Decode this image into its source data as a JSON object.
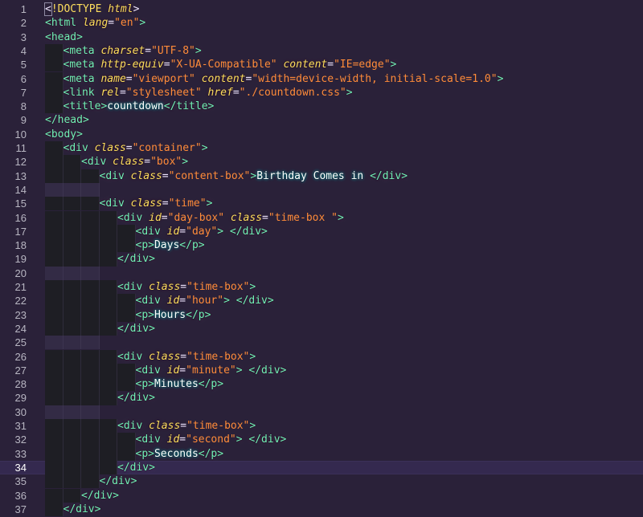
{
  "editor": {
    "language": "html",
    "active_line": 34,
    "lines": [
      {
        "n": "1",
        "indent": 0,
        "tokens": [
          [
            "punc",
            "<"
          ],
          [
            "doc",
            "!DOCTYPE "
          ],
          [
            "attr",
            "html"
          ],
          [
            "punc",
            ">"
          ]
        ]
      },
      {
        "n": "2",
        "indent": 0,
        "tokens": [
          [
            "tag",
            "<html "
          ],
          [
            "attr",
            "lang"
          ],
          [
            "punc",
            "="
          ],
          [
            "str",
            "\"en\""
          ],
          [
            "tag",
            ">"
          ]
        ]
      },
      {
        "n": "3",
        "indent": 0,
        "tokens": [
          [
            "tag",
            "<head>"
          ]
        ]
      },
      {
        "n": "4",
        "indent": 1,
        "tokens": [
          [
            "tag",
            "<meta "
          ],
          [
            "attr",
            "charset"
          ],
          [
            "punc",
            "="
          ],
          [
            "str",
            "\"UTF-8\""
          ],
          [
            "tag",
            ">"
          ]
        ]
      },
      {
        "n": "5",
        "indent": 1,
        "tokens": [
          [
            "tag",
            "<meta "
          ],
          [
            "attr",
            "http-equiv"
          ],
          [
            "punc",
            "="
          ],
          [
            "str",
            "\"X-UA-Compatible\" "
          ],
          [
            "attr",
            "content"
          ],
          [
            "punc",
            "="
          ],
          [
            "str",
            "\"IE=edge\""
          ],
          [
            "tag",
            ">"
          ]
        ]
      },
      {
        "n": "6",
        "indent": 1,
        "tokens": [
          [
            "tag",
            "<meta "
          ],
          [
            "attr",
            "name"
          ],
          [
            "punc",
            "="
          ],
          [
            "str",
            "\"viewport\" "
          ],
          [
            "attr",
            "content"
          ],
          [
            "punc",
            "="
          ],
          [
            "str",
            "\"width=device-width, initial-scale=1.0\""
          ],
          [
            "tag",
            ">"
          ]
        ]
      },
      {
        "n": "7",
        "indent": 1,
        "tokens": [
          [
            "tag",
            "<link "
          ],
          [
            "attr",
            "rel"
          ],
          [
            "punc",
            "="
          ],
          [
            "str",
            "\"stylesheet\" "
          ],
          [
            "attr",
            "href"
          ],
          [
            "punc",
            "="
          ],
          [
            "str",
            "\"./countdown.css\""
          ],
          [
            "tag",
            ">"
          ]
        ]
      },
      {
        "n": "8",
        "indent": 1,
        "tokens": [
          [
            "tag",
            "<title>"
          ],
          [
            "txt",
            "countdown"
          ],
          [
            "tag",
            "</title>"
          ]
        ]
      },
      {
        "n": "9",
        "indent": 0,
        "tokens": [
          [
            "tag",
            "</head>"
          ]
        ]
      },
      {
        "n": "10",
        "indent": 0,
        "tokens": [
          [
            "tag",
            "<body>"
          ]
        ]
      },
      {
        "n": "11",
        "indent": 1,
        "tokens": [
          [
            "tag",
            "<div "
          ],
          [
            "attr",
            "class"
          ],
          [
            "punc",
            "="
          ],
          [
            "str",
            "\"container\""
          ],
          [
            "tag",
            ">"
          ]
        ]
      },
      {
        "n": "12",
        "indent": 2,
        "tokens": [
          [
            "tag",
            "<div "
          ],
          [
            "attr",
            "class"
          ],
          [
            "punc",
            "="
          ],
          [
            "str",
            "\"box\""
          ],
          [
            "tag",
            ">"
          ]
        ]
      },
      {
        "n": "13",
        "indent": 3,
        "tokens": [
          [
            "tag",
            "<div "
          ],
          [
            "attr",
            "class"
          ],
          [
            "punc",
            "="
          ],
          [
            "str",
            "\"content-box\""
          ],
          [
            "tag",
            ">"
          ],
          [
            "txt",
            "Birthday Comes in "
          ],
          [
            "tag",
            "</div>"
          ]
        ]
      },
      {
        "n": "14",
        "indent": 3,
        "blank": true,
        "tokens": []
      },
      {
        "n": "15",
        "indent": 3,
        "tokens": [
          [
            "tag",
            "<div "
          ],
          [
            "attr",
            "class"
          ],
          [
            "punc",
            "="
          ],
          [
            "str",
            "\"time\""
          ],
          [
            "tag",
            ">"
          ]
        ]
      },
      {
        "n": "16",
        "indent": 4,
        "tokens": [
          [
            "tag",
            "<div "
          ],
          [
            "attr",
            "id"
          ],
          [
            "punc",
            "="
          ],
          [
            "str",
            "\"day-box\" "
          ],
          [
            "attr",
            "class"
          ],
          [
            "punc",
            "="
          ],
          [
            "str",
            "\"time-box \""
          ],
          [
            "tag",
            ">"
          ]
        ]
      },
      {
        "n": "17",
        "indent": 5,
        "tokens": [
          [
            "tag",
            "<div "
          ],
          [
            "attr",
            "id"
          ],
          [
            "punc",
            "="
          ],
          [
            "str",
            "\"day\""
          ],
          [
            "tag",
            ">"
          ],
          [
            "txt",
            " "
          ],
          [
            "tag",
            "</div>"
          ]
        ]
      },
      {
        "n": "18",
        "indent": 5,
        "tokens": [
          [
            "tag",
            "<p>"
          ],
          [
            "txt",
            "Days"
          ],
          [
            "tag",
            "</p>"
          ]
        ]
      },
      {
        "n": "19",
        "indent": 4,
        "tokens": [
          [
            "tag",
            "</div>"
          ]
        ]
      },
      {
        "n": "20",
        "indent": 3,
        "blank": true,
        "tokens": []
      },
      {
        "n": "21",
        "indent": 4,
        "tokens": [
          [
            "tag",
            "<div "
          ],
          [
            "attr",
            "class"
          ],
          [
            "punc",
            "="
          ],
          [
            "str",
            "\"time-box\""
          ],
          [
            "tag",
            ">"
          ]
        ]
      },
      {
        "n": "22",
        "indent": 5,
        "tokens": [
          [
            "tag",
            "<div "
          ],
          [
            "attr",
            "id"
          ],
          [
            "punc",
            "="
          ],
          [
            "str",
            "\"hour\""
          ],
          [
            "tag",
            ">"
          ],
          [
            "txt",
            " "
          ],
          [
            "tag",
            "</div>"
          ]
        ]
      },
      {
        "n": "23",
        "indent": 5,
        "tokens": [
          [
            "tag",
            "<p>"
          ],
          [
            "txt",
            "Hours"
          ],
          [
            "tag",
            "</p>"
          ]
        ]
      },
      {
        "n": "24",
        "indent": 4,
        "tokens": [
          [
            "tag",
            "</div>"
          ]
        ]
      },
      {
        "n": "25",
        "indent": 3,
        "blank": true,
        "tokens": []
      },
      {
        "n": "26",
        "indent": 4,
        "tokens": [
          [
            "tag",
            "<div "
          ],
          [
            "attr",
            "class"
          ],
          [
            "punc",
            "="
          ],
          [
            "str",
            "\"time-box\""
          ],
          [
            "tag",
            ">"
          ]
        ]
      },
      {
        "n": "27",
        "indent": 5,
        "tokens": [
          [
            "tag",
            "<div "
          ],
          [
            "attr",
            "id"
          ],
          [
            "punc",
            "="
          ],
          [
            "str",
            "\"minute\""
          ],
          [
            "tag",
            ">"
          ],
          [
            "txt",
            " "
          ],
          [
            "tag",
            "</div>"
          ]
        ]
      },
      {
        "n": "28",
        "indent": 5,
        "tokens": [
          [
            "tag",
            "<p>"
          ],
          [
            "txt",
            "Minutes"
          ],
          [
            "tag",
            "</p>"
          ]
        ]
      },
      {
        "n": "29",
        "indent": 4,
        "tokens": [
          [
            "tag",
            "</div>"
          ]
        ]
      },
      {
        "n": "30",
        "indent": 3,
        "blank": true,
        "tokens": []
      },
      {
        "n": "31",
        "indent": 4,
        "tokens": [
          [
            "tag",
            "<div "
          ],
          [
            "attr",
            "class"
          ],
          [
            "punc",
            "="
          ],
          [
            "str",
            "\"time-box\""
          ],
          [
            "tag",
            ">"
          ]
        ]
      },
      {
        "n": "32",
        "indent": 5,
        "tokens": [
          [
            "tag",
            "<div "
          ],
          [
            "attr",
            "id"
          ],
          [
            "punc",
            "="
          ],
          [
            "str",
            "\"second\""
          ],
          [
            "tag",
            ">"
          ],
          [
            "txt",
            " "
          ],
          [
            "tag",
            "</div>"
          ]
        ]
      },
      {
        "n": "33",
        "indent": 5,
        "tokens": [
          [
            "tag",
            "<p>"
          ],
          [
            "txt",
            "Seconds"
          ],
          [
            "tag",
            "</p>"
          ]
        ]
      },
      {
        "n": "34",
        "indent": 4,
        "tokens": [
          [
            "tag",
            "</div>"
          ]
        ]
      },
      {
        "n": "35",
        "indent": 3,
        "tokens": [
          [
            "tag",
            "</div>"
          ]
        ]
      },
      {
        "n": "36",
        "indent": 2,
        "tokens": [
          [
            "tag",
            "</div>"
          ]
        ]
      },
      {
        "n": "37",
        "indent": 1,
        "tokens": [
          [
            "tag",
            "</div>"
          ]
        ]
      }
    ]
  },
  "colors": {
    "background": "#2a2139",
    "tag": "#72f1b8",
    "attribute": "#fede5d",
    "string": "#ff8b39",
    "text": "#ffffff",
    "line_number": "#b8b6c2"
  }
}
